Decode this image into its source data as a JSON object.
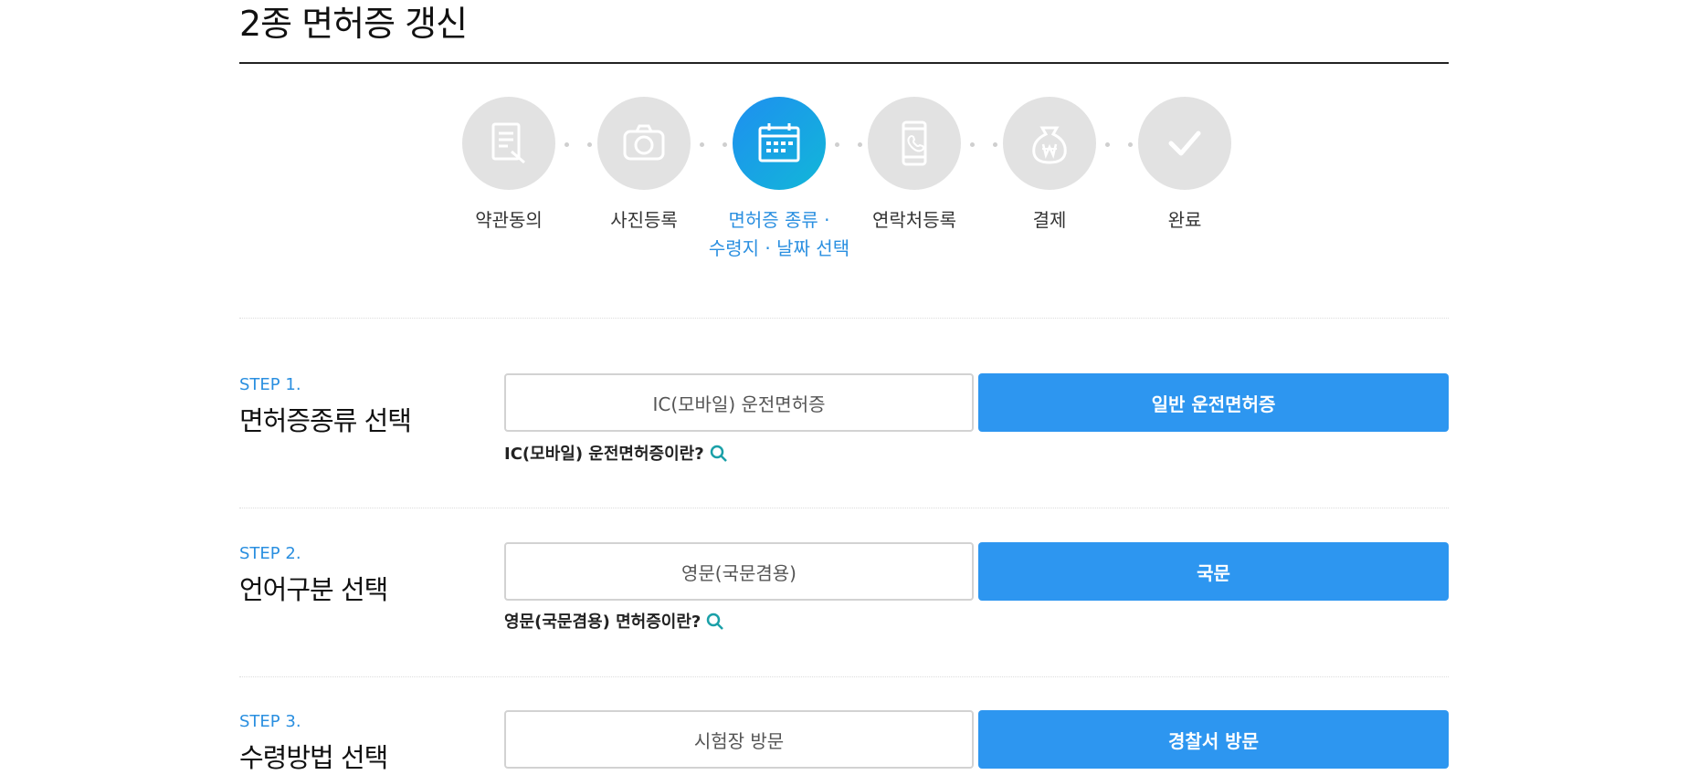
{
  "page": {
    "title": "2종 면허증 갱신"
  },
  "stepper": {
    "steps": [
      {
        "label": "약관동의",
        "icon": "document-edit-icon"
      },
      {
        "label": "사진등록",
        "icon": "camera-icon"
      },
      {
        "label_line1": "면허증 종류 ·",
        "label_line2": "수령지 · 날짜 선택",
        "icon": "calendar-icon",
        "active": true
      },
      {
        "label": "연락처등록",
        "icon": "mobile-phone-icon"
      },
      {
        "label": "결제",
        "icon": "won-bag-icon"
      },
      {
        "label": "완료",
        "icon": "check-icon"
      }
    ],
    "colors": {
      "inactive": "#e2e2e2",
      "active_start": "#1e8ff0",
      "active_end": "#12b7d8"
    }
  },
  "sections": [
    {
      "step_no": "STEP 1.",
      "heading": "면허증종류 선택",
      "option_left": "IC(모바일) 운전면허증",
      "option_right": "일반 운전면허증",
      "help": "IC(모바일) 운전면허증이란?"
    },
    {
      "step_no": "STEP 2.",
      "heading": "언어구분 선택",
      "option_left": "영문(국문겸용)",
      "option_right": "국문",
      "help": "영문(국문겸용) 면허증이란?"
    },
    {
      "step_no": "STEP 3.",
      "heading": "수령방법 선택",
      "option_left": "시험장 방문",
      "option_right": "경찰서 방문"
    }
  ],
  "colors": {
    "accent": "#2d96f0",
    "step_text": "#2a8fe0",
    "help_icon": "#1aa0a8"
  }
}
